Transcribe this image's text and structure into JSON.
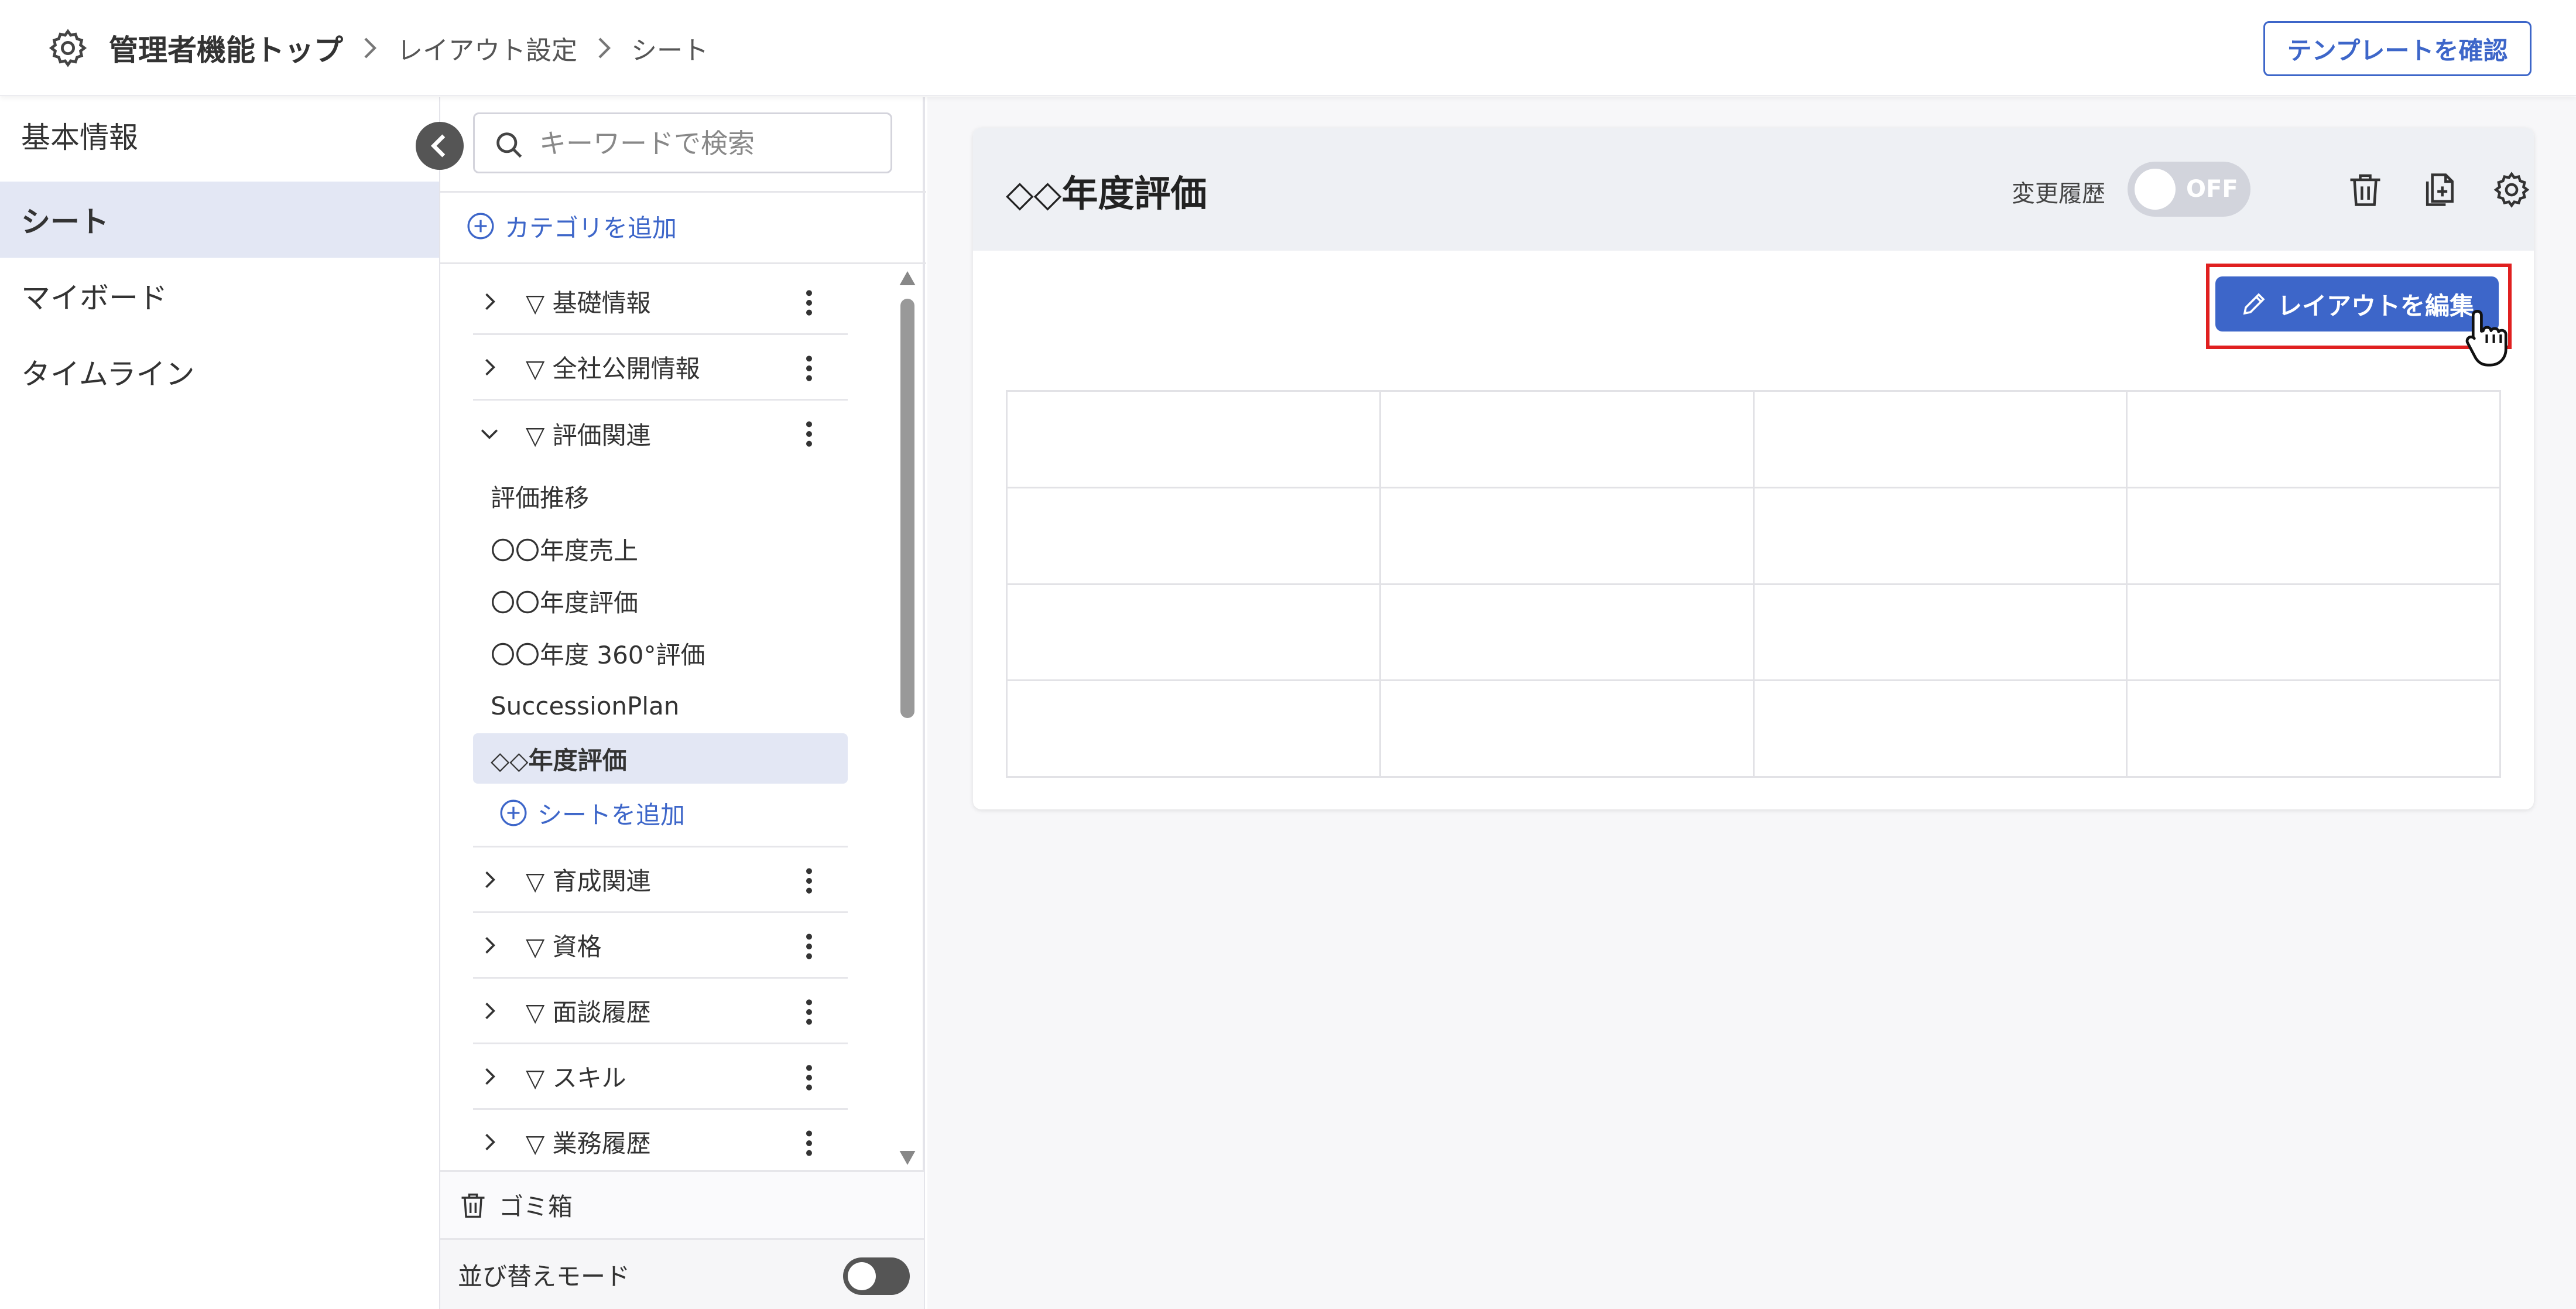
{
  "header": {
    "title": "管理者機能トップ",
    "breadcrumbs": [
      "レイアウト設定",
      "シート"
    ],
    "template_button": "テンプレートを確認"
  },
  "nav": {
    "items": [
      {
        "label": "基本情報",
        "active": false
      },
      {
        "label": "シート",
        "active": true
      },
      {
        "label": "マイボード",
        "active": false
      },
      {
        "label": "タイムライン",
        "active": false
      }
    ]
  },
  "sidebar": {
    "search_placeholder": "キーワードで検索",
    "add_category": "カテゴリを追加",
    "categories": [
      {
        "label": "▽ 基礎情報",
        "expanded": false
      },
      {
        "label": "▽ 全社公開情報",
        "expanded": false
      },
      {
        "label": "▽ 評価関連",
        "expanded": true
      },
      {
        "label": "▽ 育成関連",
        "expanded": false
      },
      {
        "label": "▽ 資格",
        "expanded": false
      },
      {
        "label": "▽ 面談履歴",
        "expanded": false
      },
      {
        "label": "▽ スキル",
        "expanded": false
      },
      {
        "label": "▽ 業務履歴",
        "expanded": false
      }
    ],
    "sheets": [
      {
        "label": "評価推移",
        "active": false
      },
      {
        "label": "〇〇年度売上",
        "active": false
      },
      {
        "label": "〇〇年度評価",
        "active": false
      },
      {
        "label": "〇〇年度 360°評価",
        "active": false
      },
      {
        "label": "SuccessionPlan",
        "active": false
      },
      {
        "label": "◇◇年度評価",
        "active": true
      }
    ],
    "add_sheet": "シートを追加",
    "trash": "ゴミ箱",
    "sort_mode": "並び替えモード",
    "sort_mode_on": false
  },
  "main": {
    "sheet_title": "◇◇年度評価",
    "history_label": "変更履歴",
    "history_toggle": "OFF",
    "edit_layout_button": "レイアウトを編集",
    "grid": {
      "rows": 4,
      "cols": 4
    }
  },
  "colors": {
    "accent": "#3d66c9",
    "highlight": "#e02020",
    "selected_bg": "#e3e7f4"
  }
}
